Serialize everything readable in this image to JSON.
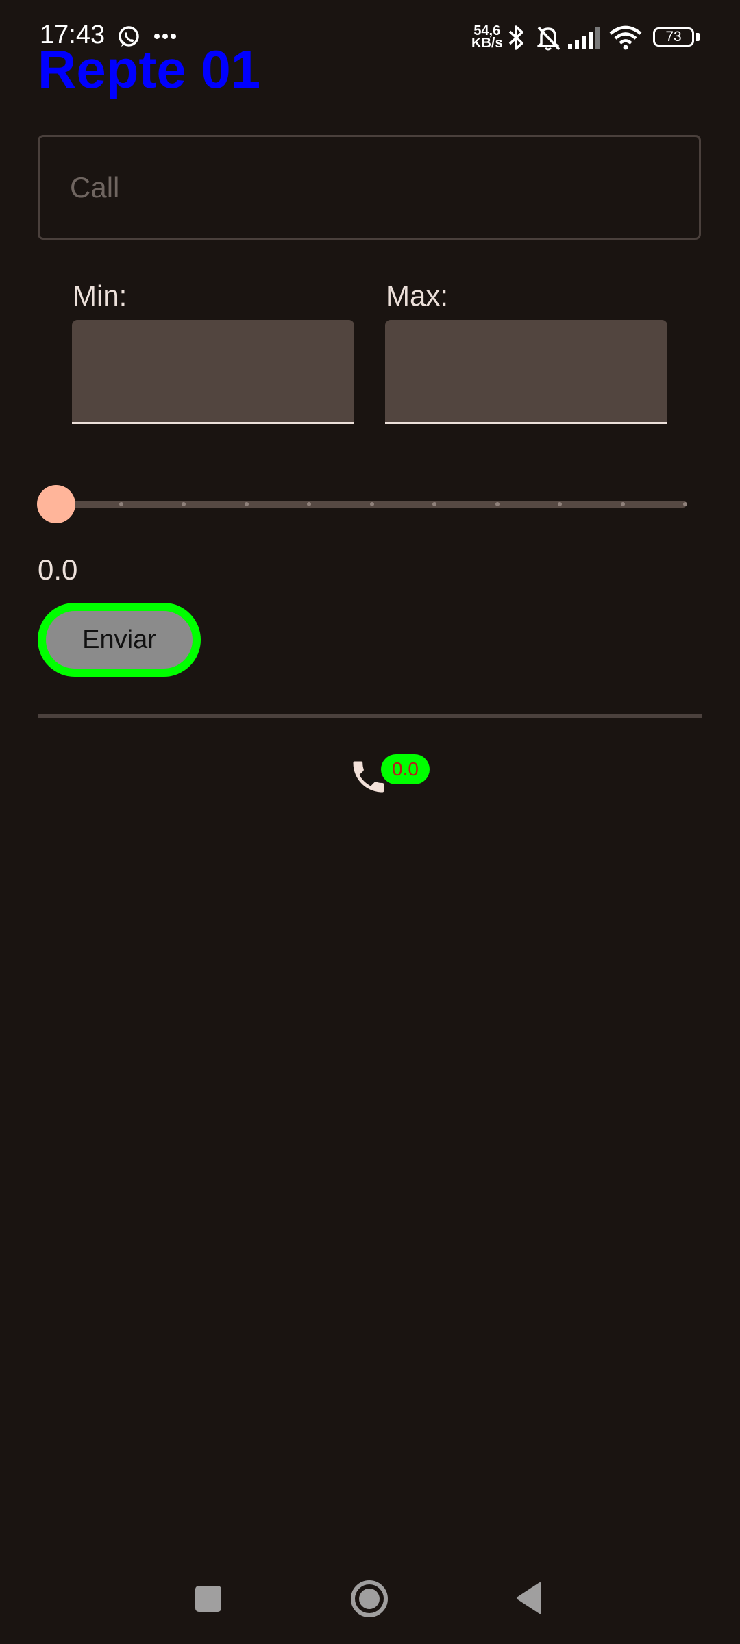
{
  "status_bar": {
    "time": "17:43",
    "speed_value": "54,6",
    "speed_unit": "KB/s",
    "battery": "73",
    "icons": [
      "whatsapp-icon",
      "more-dots-icon",
      "bluetooth-icon",
      "bell-muted-icon",
      "signal-icon",
      "wifi-icon",
      "battery-icon"
    ]
  },
  "app": {
    "title": "Repte 01"
  },
  "form": {
    "call_placeholder": "Call",
    "min_label": "Min:",
    "max_label": "Max:",
    "min_value": "",
    "max_value": ""
  },
  "slider": {
    "value": 0.0,
    "value_text": "0.0",
    "ticks": 11
  },
  "send_button": {
    "label": "Enviar"
  },
  "result": {
    "badge_text": "0.0"
  },
  "colors": {
    "background": "#1a1411",
    "title": "#0000ff",
    "accent_green": "#00ff00",
    "thumb": "#ffb59a",
    "badge_text": "#b71c1c"
  },
  "nav_bar": {
    "icons": [
      "recents-icon",
      "home-icon",
      "back-icon"
    ]
  }
}
